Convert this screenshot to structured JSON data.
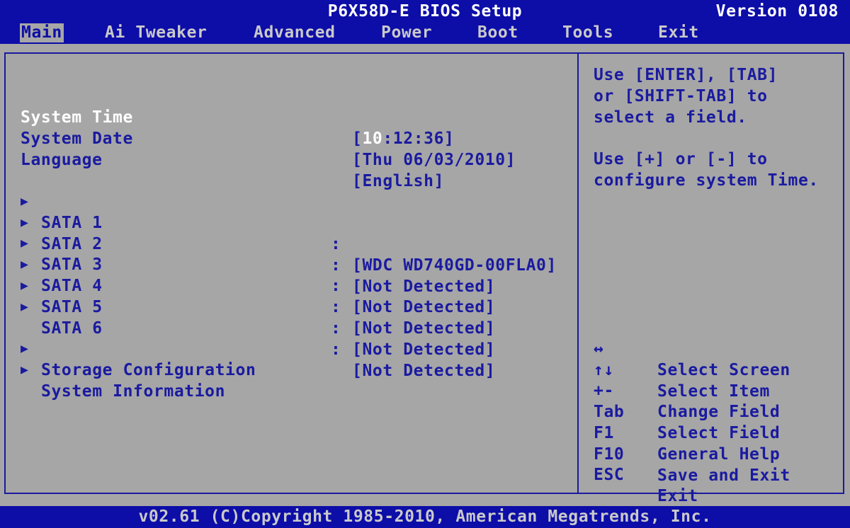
{
  "title_bar": {
    "title": "P6X58D-E BIOS Setup",
    "version": "Version 0108"
  },
  "menu": {
    "items": [
      {
        "label": "Main",
        "active": true
      },
      {
        "label": "Ai Tweaker",
        "active": false
      },
      {
        "label": "Advanced",
        "active": false
      },
      {
        "label": "Power",
        "active": false
      },
      {
        "label": "Boot",
        "active": false
      },
      {
        "label": "Tools",
        "active": false
      },
      {
        "label": "Exit",
        "active": false
      }
    ]
  },
  "main": {
    "system_time": {
      "label": "System Time",
      "value_open": "[",
      "value_hl": "10",
      "value_rest": ":12:36]"
    },
    "system_date": {
      "label": "System Date",
      "value": "[Thu 06/03/2010]"
    },
    "language": {
      "label": "Language",
      "value": "[English]"
    },
    "arrow": "▶",
    "colon": ":",
    "sata": [
      {
        "label": "SATA 1",
        "value": "[WDC WD740GD-00FLA0]"
      },
      {
        "label": "SATA 2",
        "value": "[Not Detected]"
      },
      {
        "label": "SATA 3",
        "value": "[Not Detected]"
      },
      {
        "label": "SATA 4",
        "value": "[Not Detected]"
      },
      {
        "label": "SATA 5",
        "value": "[Not Detected]"
      },
      {
        "label": "SATA 6",
        "value": "[Not Detected]"
      }
    ],
    "submenus": [
      {
        "label": "Storage Configuration"
      },
      {
        "label": "System Information"
      }
    ]
  },
  "help": {
    "lines": [
      "Use [ENTER], [TAB]",
      "or [SHIFT-TAB] to",
      "select a field.",
      "",
      "Use [+] or [-] to",
      "configure system Time."
    ],
    "keys": [
      {
        "key": "↔",
        "desc": "Select Screen"
      },
      {
        "key": "↑↓",
        "desc": "Select Item"
      },
      {
        "key": "+-",
        "desc": "Change Field"
      },
      {
        "key": "Tab",
        "desc": "Select Field"
      },
      {
        "key": "F1",
        "desc": "General Help"
      },
      {
        "key": "F10",
        "desc": "Save and Exit"
      },
      {
        "key": "ESC",
        "desc": "Exit"
      }
    ]
  },
  "footer": {
    "copyright": "v02.61 (C)Copyright 1985-2010, American Megatrends, Inc."
  },
  "colors": {
    "bar_blue": "#0d0da8",
    "text_blue": "#1a1aa0",
    "panel_gray": "#a6a6a6",
    "highlight_white": "#ffffff"
  }
}
